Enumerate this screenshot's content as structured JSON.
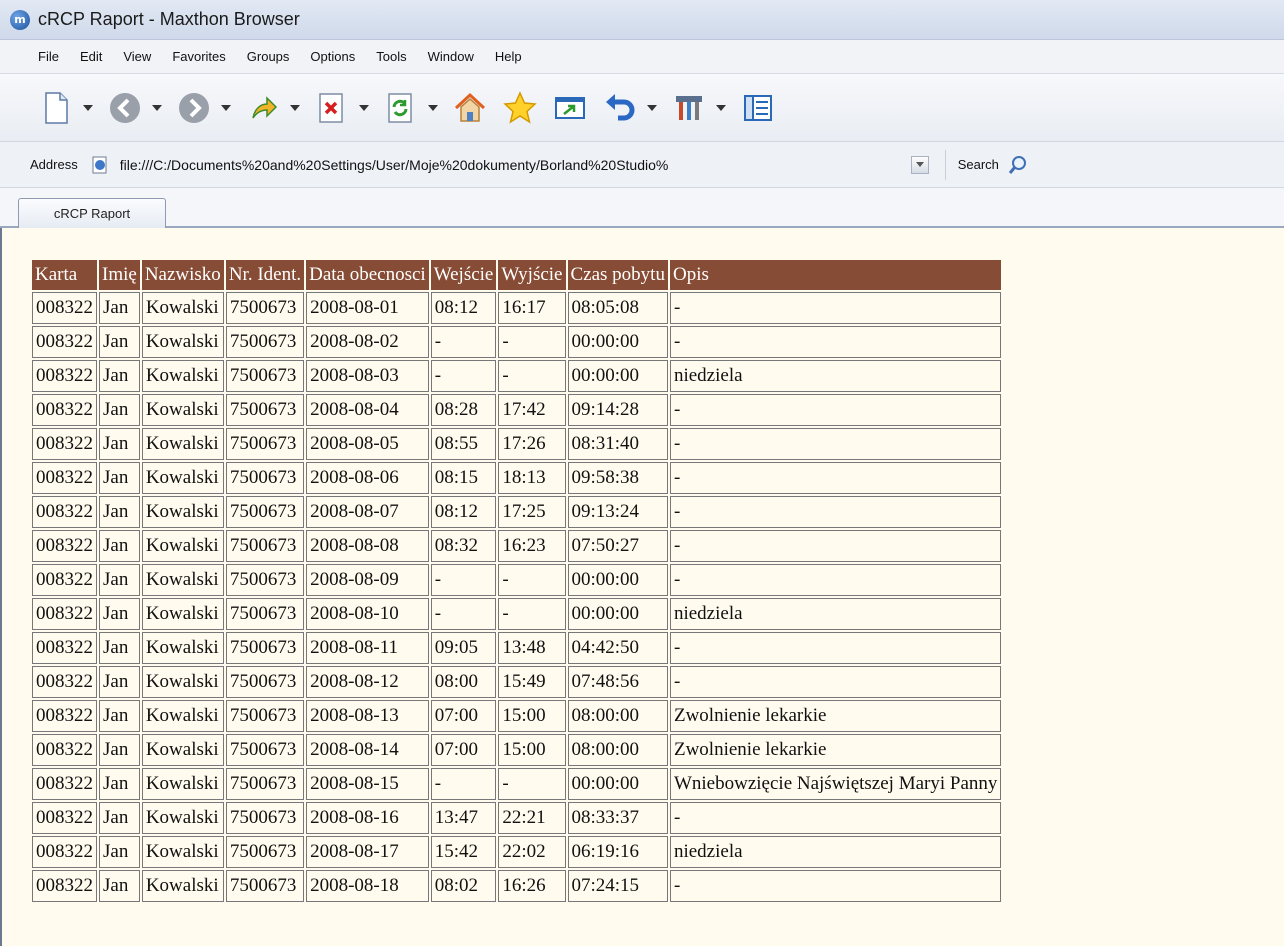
{
  "window": {
    "title": "cRCP Raport - Maxthon Browser",
    "logo_text": "m"
  },
  "menu": [
    "File",
    "Edit",
    "View",
    "Favorites",
    "Groups",
    "Options",
    "Tools",
    "Window",
    "Help"
  ],
  "toolbar": {
    "buttons": [
      {
        "name": "new-page-icon",
        "dropdown": true
      },
      {
        "name": "back-icon",
        "dropdown": true
      },
      {
        "name": "forward-icon",
        "dropdown": true
      },
      {
        "name": "up-icon",
        "dropdown": true
      },
      {
        "name": "stop-icon",
        "dropdown": true
      },
      {
        "name": "refresh-icon",
        "dropdown": true
      },
      {
        "name": "home-icon",
        "dropdown": false
      },
      {
        "name": "favorites-star-icon",
        "dropdown": false
      },
      {
        "name": "open-window-icon",
        "dropdown": false
      },
      {
        "name": "undo-icon",
        "dropdown": true
      },
      {
        "name": "tools-icon",
        "dropdown": true
      },
      {
        "name": "sidebar-icon",
        "dropdown": false
      }
    ]
  },
  "address": {
    "label": "Address",
    "value": "file:///C:/Documents%20and%20Settings/User/Moje%20dokumenty/Borland%20Studio%"
  },
  "search": {
    "label": "Search",
    "placeholder": ""
  },
  "tab": {
    "label": "cRCP Raport"
  },
  "report": {
    "headers": [
      "Karta",
      "Imię",
      "Nazwisko",
      "Nr. Ident.",
      "Data obecnosci",
      "Wejście",
      "Wyjście",
      "Czas pobytu",
      "Opis"
    ],
    "rows": [
      [
        "008322",
        "Jan",
        "Kowalski",
        "7500673",
        "2008-08-01",
        "08:12",
        "16:17",
        "08:05:08",
        "-"
      ],
      [
        "008322",
        "Jan",
        "Kowalski",
        "7500673",
        "2008-08-02",
        "-",
        "-",
        "00:00:00",
        "-"
      ],
      [
        "008322",
        "Jan",
        "Kowalski",
        "7500673",
        "2008-08-03",
        "-",
        "-",
        "00:00:00",
        "niedziela"
      ],
      [
        "008322",
        "Jan",
        "Kowalski",
        "7500673",
        "2008-08-04",
        "08:28",
        "17:42",
        "09:14:28",
        "-"
      ],
      [
        "008322",
        "Jan",
        "Kowalski",
        "7500673",
        "2008-08-05",
        "08:55",
        "17:26",
        "08:31:40",
        "-"
      ],
      [
        "008322",
        "Jan",
        "Kowalski",
        "7500673",
        "2008-08-06",
        "08:15",
        "18:13",
        "09:58:38",
        "-"
      ],
      [
        "008322",
        "Jan",
        "Kowalski",
        "7500673",
        "2008-08-07",
        "08:12",
        "17:25",
        "09:13:24",
        "-"
      ],
      [
        "008322",
        "Jan",
        "Kowalski",
        "7500673",
        "2008-08-08",
        "08:32",
        "16:23",
        "07:50:27",
        "-"
      ],
      [
        "008322",
        "Jan",
        "Kowalski",
        "7500673",
        "2008-08-09",
        "-",
        "-",
        "00:00:00",
        "-"
      ],
      [
        "008322",
        "Jan",
        "Kowalski",
        "7500673",
        "2008-08-10",
        "-",
        "-",
        "00:00:00",
        "niedziela"
      ],
      [
        "008322",
        "Jan",
        "Kowalski",
        "7500673",
        "2008-08-11",
        "09:05",
        "13:48",
        "04:42:50",
        "-"
      ],
      [
        "008322",
        "Jan",
        "Kowalski",
        "7500673",
        "2008-08-12",
        "08:00",
        "15:49",
        "07:48:56",
        "-"
      ],
      [
        "008322",
        "Jan",
        "Kowalski",
        "7500673",
        "2008-08-13",
        "07:00",
        "15:00",
        "08:00:00",
        "Zwolnienie lekarkie"
      ],
      [
        "008322",
        "Jan",
        "Kowalski",
        "7500673",
        "2008-08-14",
        "07:00",
        "15:00",
        "08:00:00",
        "Zwolnienie lekarkie"
      ],
      [
        "008322",
        "Jan",
        "Kowalski",
        "7500673",
        "2008-08-15",
        "-",
        "-",
        "00:00:00",
        "Wniebowzięcie Najświętszej Maryi Panny"
      ],
      [
        "008322",
        "Jan",
        "Kowalski",
        "7500673",
        "2008-08-16",
        "13:47",
        "22:21",
        "08:33:37",
        "-"
      ],
      [
        "008322",
        "Jan",
        "Kowalski",
        "7500673",
        "2008-08-17",
        "15:42",
        "22:02",
        "06:19:16",
        "niedziela"
      ],
      [
        "008322",
        "Jan",
        "Kowalski",
        "7500673",
        "2008-08-18",
        "08:02",
        "16:26",
        "07:24:15",
        "-"
      ]
    ]
  },
  "colors": {
    "header_bg": "#874c35",
    "content_bg": "#fffbef"
  }
}
